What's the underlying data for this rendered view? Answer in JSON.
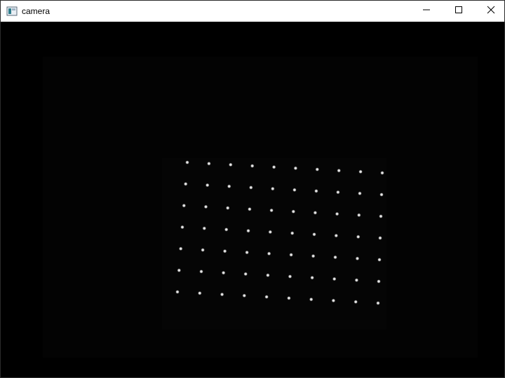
{
  "window": {
    "title": "camera",
    "icons": {
      "app": "window-app-icon",
      "minimize": "minimize-icon",
      "maximize": "maximize-icon",
      "close": "close-icon"
    }
  },
  "camera_view": {
    "description_color": "#000000",
    "dot_color": "#f2f2f2",
    "grid": {
      "rows": 7,
      "cols": 10
    }
  }
}
